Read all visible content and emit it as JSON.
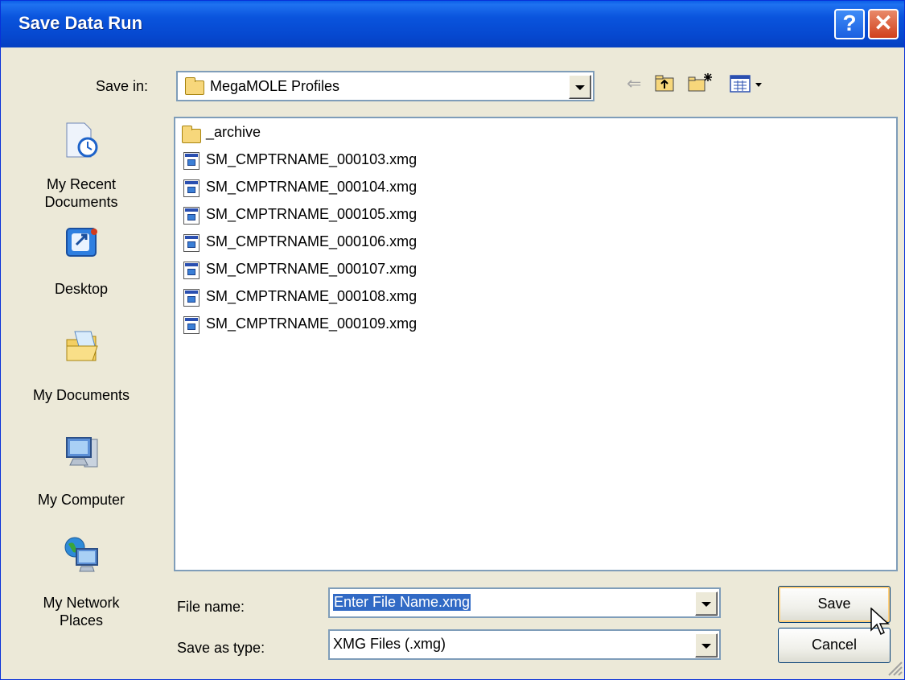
{
  "window": {
    "title": "Save Data Run"
  },
  "titlebar": {
    "help_glyph": "?",
    "close_glyph": "✕"
  },
  "toolbar": {
    "save_in_label": "Save in:",
    "save_in_value": "MegaMOLE Profiles",
    "icons": [
      "back-arrow-icon",
      "up-folder-icon",
      "new-folder-icon",
      "view-menu-icon"
    ]
  },
  "places": [
    {
      "label": "My Recent Documents",
      "icon": "recent-documents-icon"
    },
    {
      "label": "Desktop",
      "icon": "desktop-icon"
    },
    {
      "label": "My Documents",
      "icon": "my-documents-icon"
    },
    {
      "label": "My Computer",
      "icon": "my-computer-icon"
    },
    {
      "label": "My Network Places",
      "icon": "network-places-icon"
    }
  ],
  "files": [
    {
      "name": "_archive",
      "type": "folder"
    },
    {
      "name": "SM_CMPTRNAME_000103.xmg",
      "type": "xmg"
    },
    {
      "name": "SM_CMPTRNAME_000104.xmg",
      "type": "xmg"
    },
    {
      "name": "SM_CMPTRNAME_000105.xmg",
      "type": "xmg"
    },
    {
      "name": "SM_CMPTRNAME_000106.xmg",
      "type": "xmg"
    },
    {
      "name": "SM_CMPTRNAME_000107.xmg",
      "type": "xmg"
    },
    {
      "name": "SM_CMPTRNAME_000108.xmg",
      "type": "xmg"
    },
    {
      "name": "SM_CMPTRNAME_000109.xmg",
      "type": "xmg"
    }
  ],
  "form": {
    "file_name_label": "File name:",
    "file_name_value": "Enter File Name.xmg",
    "save_as_type_label": "Save as type:",
    "save_as_type_value": "XMG Files (.xmg)"
  },
  "buttons": {
    "save": "Save",
    "cancel": "Cancel"
  },
  "colors": {
    "titlebar": "#0a54dd",
    "selection": "#316ac5",
    "dialog_bg": "#ece9d8"
  }
}
